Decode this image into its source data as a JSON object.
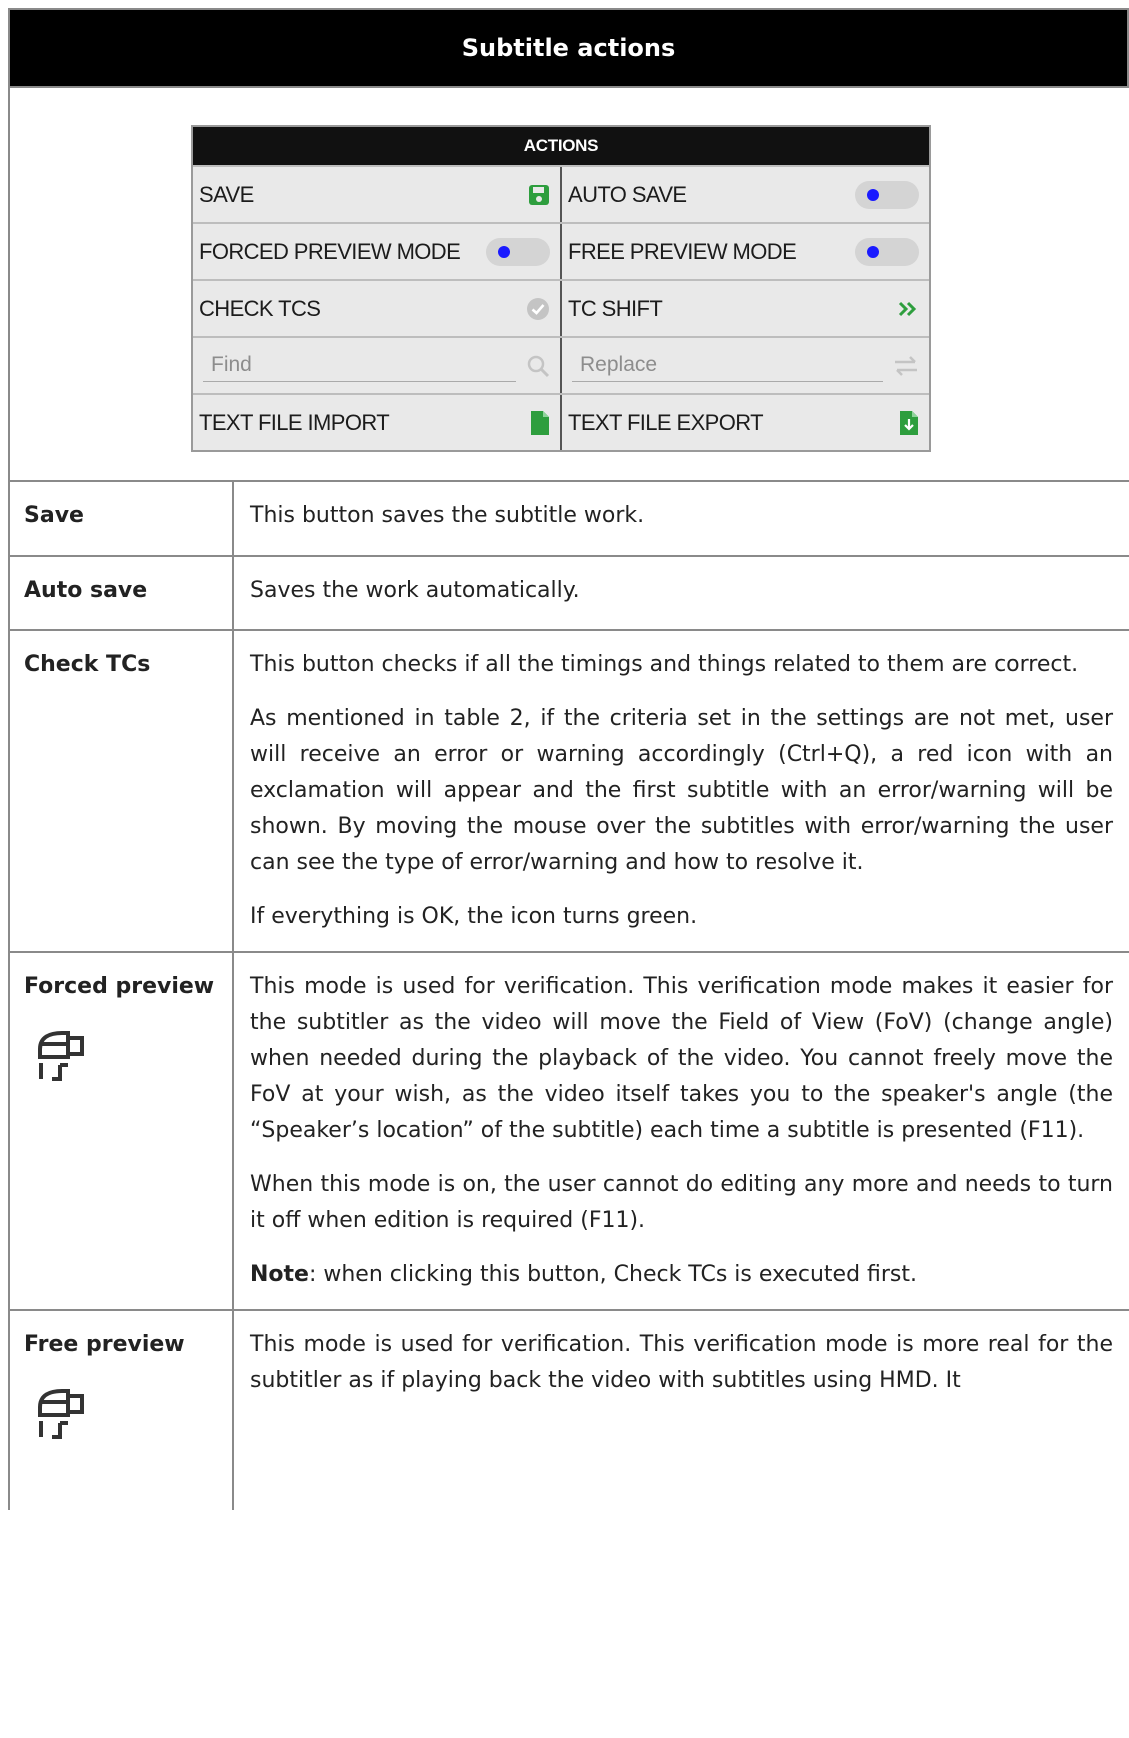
{
  "header": {
    "title": "Subtitle actions"
  },
  "actions_panel": {
    "title": "ACTIONS",
    "save_label": "SAVE",
    "auto_save_label": "AUTO SAVE",
    "forced_preview_label": "FORCED PREVIEW MODE",
    "free_preview_label": "FREE PREVIEW MODE",
    "check_tcs_label": "CHECK TCS",
    "tc_shift_label": "TC SHIFT",
    "find_placeholder": "Find",
    "replace_placeholder": "Replace",
    "text_import_label": "TEXT FILE IMPORT",
    "text_export_label": "TEXT FILE EXPORT",
    "save_icon_color": "#2e9e3e",
    "toggle_dot_color": "#1a1aff"
  },
  "rows": {
    "save": {
      "label": "Save",
      "text": "This button saves the subtitle work."
    },
    "auto_save": {
      "label": "Auto save",
      "text": "Saves the work automatically."
    },
    "check_tcs": {
      "label": "Check TCs",
      "p1": "This button checks if all the timings and things related to them are correct.",
      "p2": "As mentioned in table 2, if the criteria set in the settings are not met, user will receive an error or warning accordingly (Ctrl+Q), a red icon with an exclamation will appear and the first subtitle with an error/warning will be shown. By moving the mouse over the subtitles with error/warning the user can see the type of error/warning and how to resolve it.",
      "p3": "If everything is OK, the icon turns green."
    },
    "forced_preview": {
      "label": "Forced preview",
      "p1": "This mode is used for verification. This verification mode makes it easier for the subtitler as the video will move the Field of View (FoV) (change angle) when needed during the playback of the video. You cannot freely move the FoV at your wish, as the video itself takes you to the speaker's angle (the “Speaker’s location” of the subtitle) each time a subtitle is presented (F11).",
      "p2": "When this mode is on, the user cannot do editing any more and needs to turn it off when edition is required (F11).",
      "note_bold": "Note",
      "note_rest": ": when clicking this button, Check TCs is executed first."
    },
    "free_preview": {
      "label": "Free preview",
      "p1": "This mode is used for verification. This verification mode is more real for the subtitler as if playing back the video with subtitles using HMD. It"
    }
  }
}
